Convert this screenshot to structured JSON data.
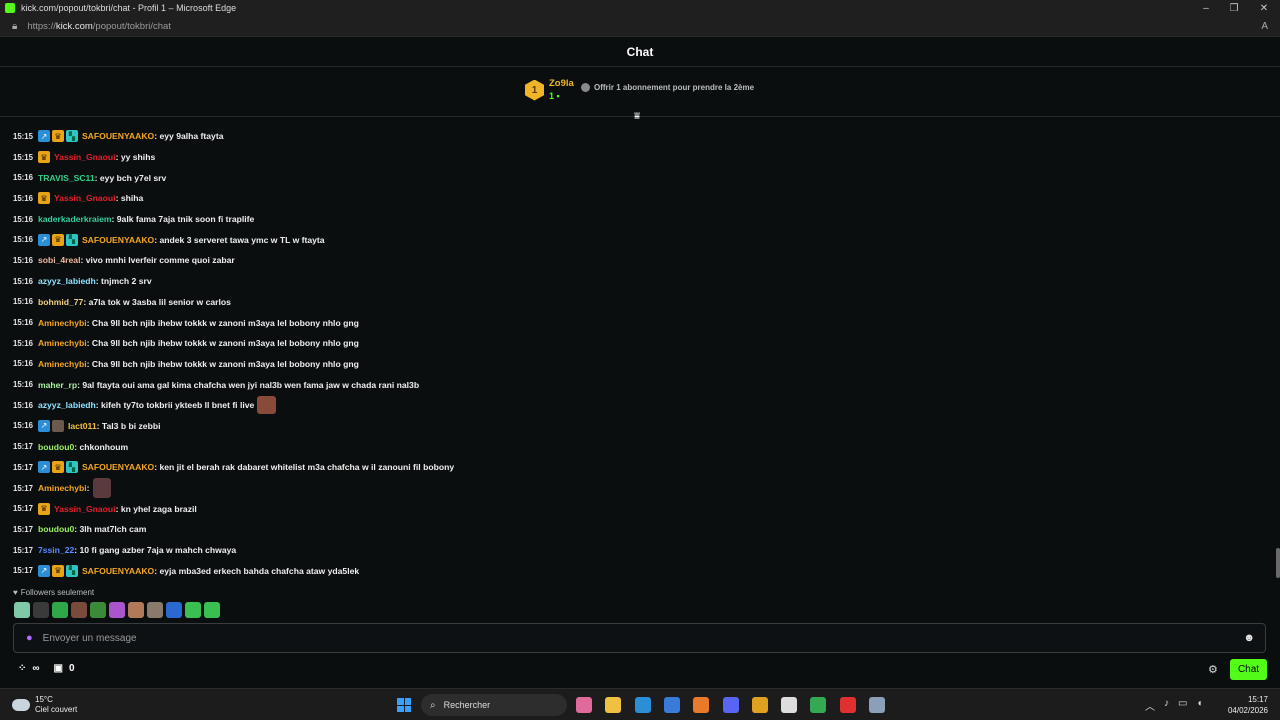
{
  "window": {
    "title": "kick.com/popout/tokbri/chat - Profil 1 – Microsoft Edge",
    "url_prefix": "https://",
    "url_host": "kick.com",
    "url_path": "/popout/tokbri/chat"
  },
  "chat": {
    "title": "Chat",
    "pinned": {
      "rank": "1",
      "gifter": "Zo9la",
      "gift_count": "1",
      "offer_text": "Offrir 1 abonnement pour prendre la 2ème"
    },
    "messages": [
      {
        "time": "15:15",
        "badges": [
          "vip",
          "crown",
          "sub"
        ],
        "user": "SAFOUENYAAKO",
        "color": "#f5a623",
        "text": ": eyy 9alha ftayta"
      },
      {
        "time": "15:15",
        "badges": [
          "crown"
        ],
        "user": "Yassin_Gnaoui",
        "color": "#e8202a",
        "text": ": yy shihs"
      },
      {
        "time": "15:16",
        "badges": [],
        "user": "TRAVIS_SC11",
        "color": "#2fd08a",
        "text": ": eyy bch y7el srv"
      },
      {
        "time": "15:16",
        "badges": [
          "crown"
        ],
        "user": "Yassin_Gnaoui",
        "color": "#e8202a",
        "text": ": shiha"
      },
      {
        "time": "15:16",
        "badges": [],
        "user": "kaderkaderkraiem",
        "color": "#2fd0a0",
        "text": ": 9alk fama 7aja tnik soon fi traplife"
      },
      {
        "time": "15:16",
        "badges": [
          "vip",
          "crown",
          "sub"
        ],
        "user": "SAFOUENYAAKO",
        "color": "#f5a623",
        "text": ": andek 3 serveret tawa ymc w TL w ftayta"
      },
      {
        "time": "15:16",
        "badges": [],
        "user": "sobi_4real",
        "color": "#f0b8a0",
        "text": ": vivo mnhi lverfeir comme quoi zabar"
      },
      {
        "time": "15:16",
        "badges": [],
        "user": "azyyz_labiedh",
        "color": "#8fe3ff",
        "text": ": tnjmch 2 srv"
      },
      {
        "time": "15:16",
        "badges": [],
        "user": "bohmid_77",
        "color": "#f0d080",
        "text": ": a7la tok w 3asba lil senior w carlos"
      },
      {
        "time": "15:16",
        "badges": [],
        "user": "Aminechybi",
        "color": "#f5a623",
        "text": ": Cha 9ll bch njib ihebw tokkk w zanoni m3aya lel bobony nhlo gng"
      },
      {
        "time": "15:16",
        "badges": [],
        "user": "Aminechybi",
        "color": "#f5a623",
        "text": ": Cha 9ll bch njib ihebw tokkk w zanoni m3aya lel bobony nhlo gng"
      },
      {
        "time": "15:16",
        "badges": [],
        "user": "Aminechybi",
        "color": "#f5a623",
        "text": ": Cha 9ll bch njib ihebw tokkk w zanoni m3aya lel bobony nhlo gng"
      },
      {
        "time": "15:16",
        "badges": [],
        "user": "maher_rp",
        "color": "#a8f0a0",
        "text": ": 9al ftayta oui ama gal kima chafcha wen jyi nal3b wen fama jaw w chada rani nal3b"
      },
      {
        "time": "15:16",
        "badges": [],
        "user": "azyyz_labiedh",
        "color": "#8fe3ff",
        "text": ": kifeh ty7to tokbrii ykteeb ll bnet fi live",
        "emote": true
      },
      {
        "time": "15:16",
        "badges": [
          "vip",
          "pic"
        ],
        "user": "lact011",
        "color": "#f5c040",
        "text": ": Tal3 b bi zebbi"
      },
      {
        "time": "15:17",
        "badges": [],
        "user": "boudou0",
        "color": "#9cf060",
        "text": ": chkonhoum"
      },
      {
        "time": "15:17",
        "badges": [
          "vip",
          "crown",
          "sub"
        ],
        "user": "SAFOUENYAAKO",
        "color": "#f5a623",
        "text": ": ken jit el berah rak dabaret whitelist m3a chafcha w il zanouni fil bobony"
      },
      {
        "time": "15:17",
        "badges": [],
        "user": "Aminechybi",
        "color": "#f5a623",
        "text": ":",
        "emote2": true
      },
      {
        "time": "15:17",
        "badges": [
          "crown"
        ],
        "user": "Yassin_Gnaoui",
        "color": "#e8202a",
        "text": ": kn yhel zaga brazil"
      },
      {
        "time": "15:17",
        "badges": [],
        "user": "boudou0",
        "color": "#9cf060",
        "text": ": 3lh mat7lch cam"
      },
      {
        "time": "15:17",
        "badges": [],
        "user": "7ssin_22",
        "color": "#5a8cff",
        "text": ": 10 fi gang azber 7aja w mahch chwaya"
      },
      {
        "time": "15:17",
        "badges": [
          "vip",
          "crown",
          "sub"
        ],
        "user": "SAFOUENYAAKO",
        "color": "#f5a623",
        "text": ": eyja mba3ed erkech bahda chafcha ataw yda5lek"
      }
    ],
    "followers_only": "Followers seulement",
    "emote_colors": [
      "#7fc8a8",
      "#3a3a3a",
      "#2fa84a",
      "#7a4a3a",
      "#3a8a3a",
      "#aa55cc",
      "#b07a5a",
      "#8a7a6a",
      "#2a6ad0",
      "#3ac050",
      "#3ac050"
    ],
    "input_placeholder": "Envoyer un message",
    "viewer_infinity": "∞",
    "store_count": "0",
    "chat_button": "Chat"
  },
  "taskbar": {
    "temperature": "15°C",
    "weather": "Ciel couvert",
    "search_label": "Rechercher",
    "time": "15:17",
    "date": "04/02/2026",
    "app_icon_colors": [
      "#e06b9a",
      "#f0c040",
      "#2b8fd8",
      "#3a7ad8",
      "#e87a2a",
      "#5865f2",
      "#e0a020",
      "#dddddd",
      "#34a853",
      "#e03030",
      "#8aa0b8"
    ]
  }
}
